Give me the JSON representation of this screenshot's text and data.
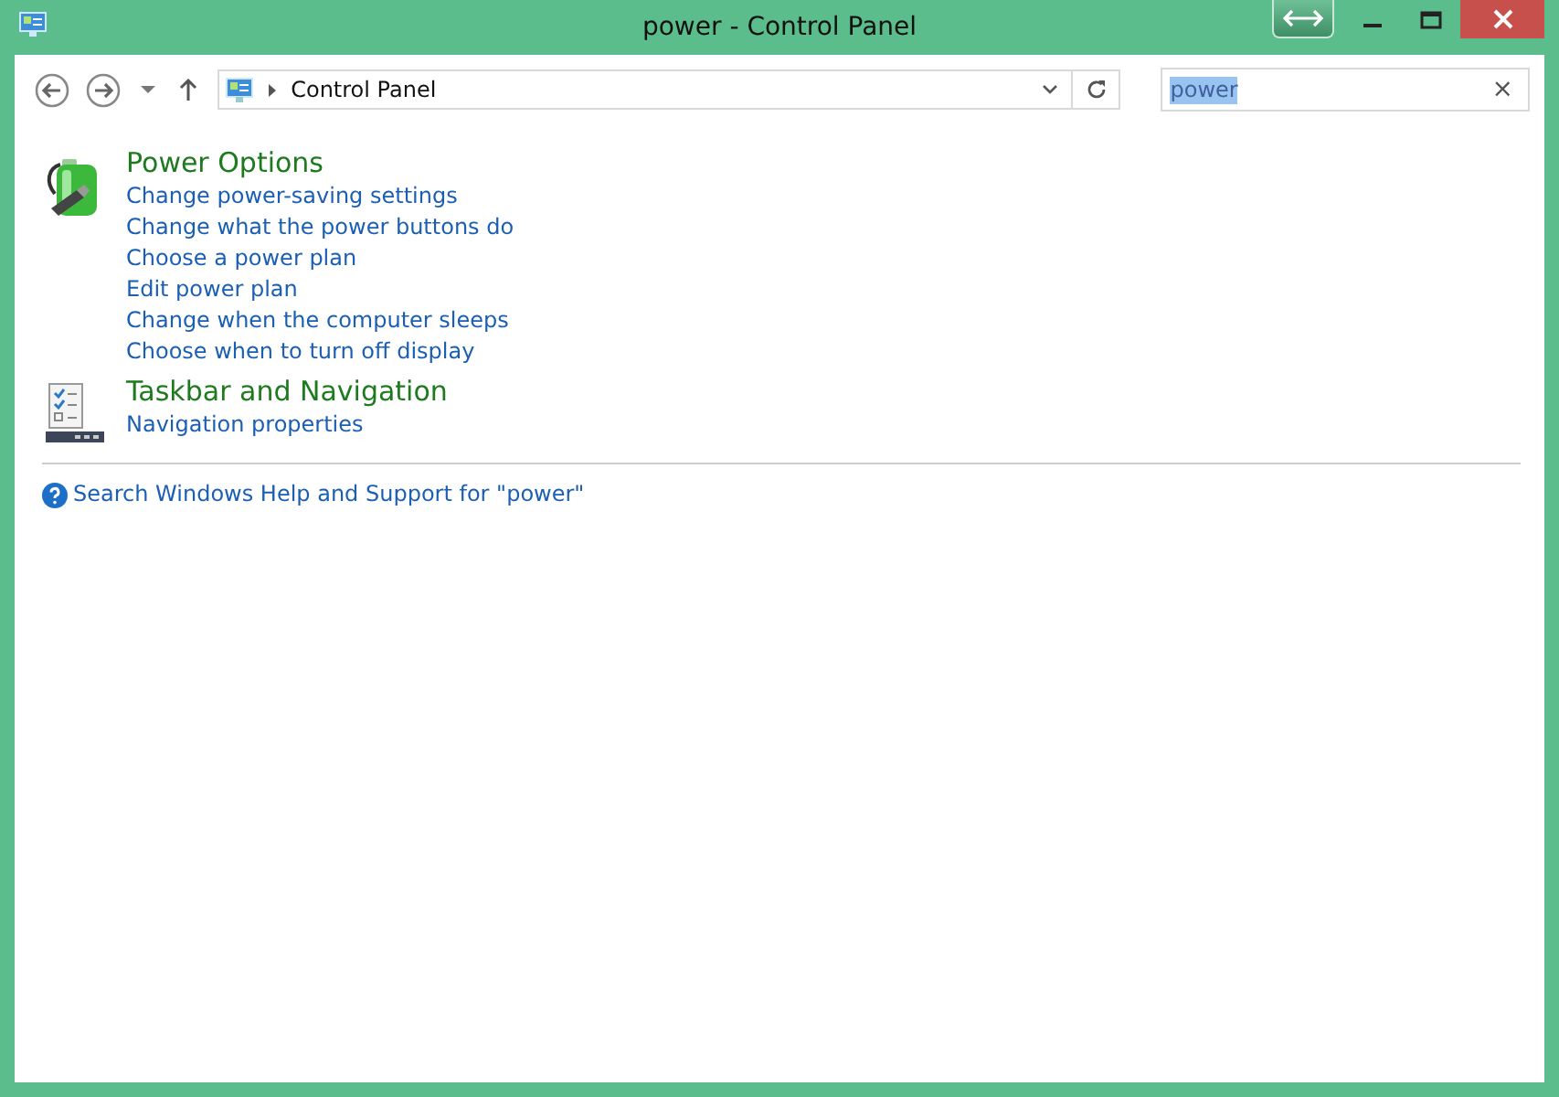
{
  "window": {
    "title": "power - Control Panel"
  },
  "address": {
    "crumbs": [
      "Control Panel"
    ]
  },
  "search": {
    "value": "power",
    "highlighted": true,
    "clear": "×"
  },
  "sections": [
    {
      "kind": "power",
      "title": "Power Options",
      "links": [
        "Change power-saving settings",
        "Change what the power buttons do",
        "Choose a power plan",
        "Edit power plan",
        "Change when the computer sleeps",
        "Choose when to turn off display"
      ]
    },
    {
      "kind": "taskbar",
      "title": "Taskbar and Navigation",
      "links": [
        "Navigation properties"
      ]
    }
  ],
  "help_link": "Search Windows Help and Support for \"power\""
}
